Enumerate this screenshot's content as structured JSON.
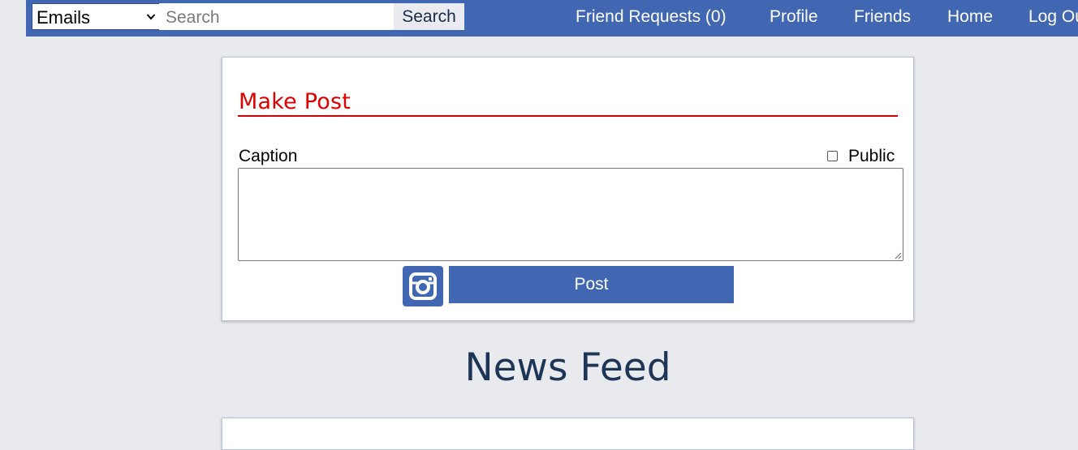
{
  "nav": {
    "filter": {
      "selected": "Emails"
    },
    "search": {
      "placeholder": "Search",
      "button_label": "Search"
    },
    "links": {
      "friend_requests": "Friend Requests (0)",
      "profile": "Profile",
      "friends": "Friends",
      "home": "Home",
      "logout": "Log Out"
    }
  },
  "make_post": {
    "title": "Make Post",
    "caption_label": "Caption",
    "public_label": "Public",
    "public_checked": false,
    "caption_value": "",
    "photo_icon": "camera-icon",
    "post_button_label": "Post"
  },
  "feed": {
    "heading": "News Feed"
  },
  "colors": {
    "nav_background": "#4267b2",
    "page_background": "#e9eaee",
    "make_post_title": "#e00000",
    "feed_heading": "#1d3557"
  }
}
